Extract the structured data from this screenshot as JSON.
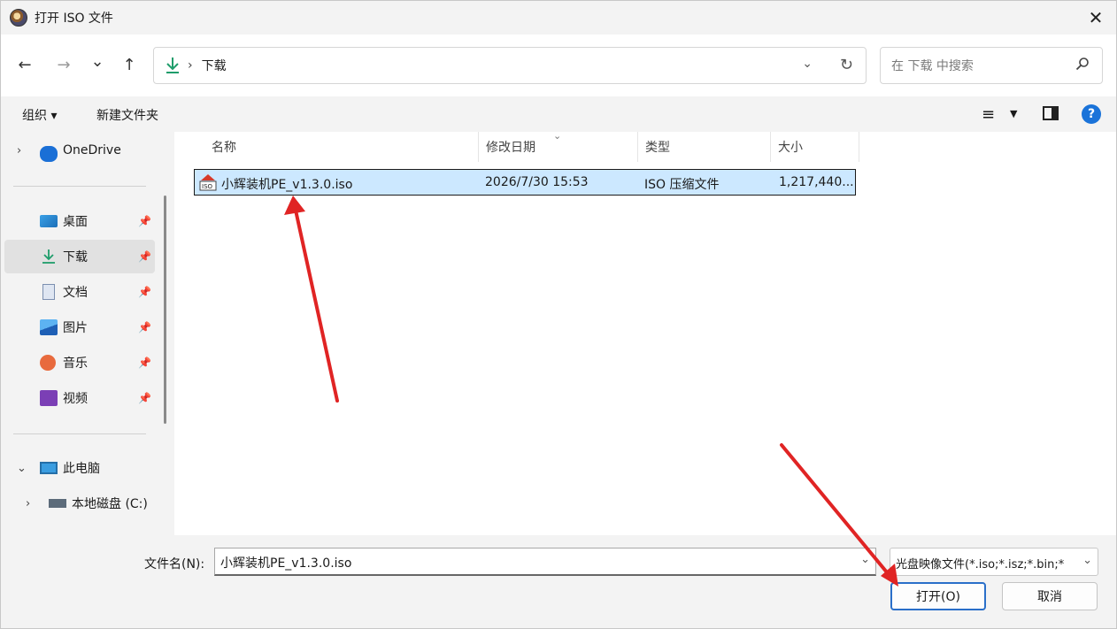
{
  "window": {
    "title": "打开 ISO 文件",
    "close_glyph": "✕"
  },
  "nav": {
    "back_glyph": "←",
    "forward_glyph": "→",
    "recent_glyph": "⌄",
    "up_glyph": "↑",
    "breadcrumb_sep": "›",
    "path": "下载",
    "address_dropdown_glyph": "⌄",
    "refresh_glyph": "↻",
    "search_placeholder": "在 下载 中搜索"
  },
  "toolbar": {
    "organize": "组织 ▾",
    "new_folder": "新建文件夹",
    "view_glyph": "≡",
    "view_caret": "▼",
    "help": "?"
  },
  "sidebar": {
    "items": [
      {
        "label": "OneDrive",
        "icon": "onedrive-icon",
        "pinned": false
      },
      {
        "label": "桌面",
        "icon": "desktop-icon",
        "pinned": true
      },
      {
        "label": "下载",
        "icon": "download-icon",
        "pinned": true,
        "selected": true
      },
      {
        "label": "文档",
        "icon": "documents-icon",
        "pinned": true
      },
      {
        "label": "图片",
        "icon": "pictures-icon",
        "pinned": true
      },
      {
        "label": "音乐",
        "icon": "music-icon",
        "pinned": true
      },
      {
        "label": "视频",
        "icon": "videos-icon",
        "pinned": true
      },
      {
        "label": "此电脑",
        "icon": "this-pc-icon"
      },
      {
        "label": "本地磁盘 (C:)",
        "icon": "drive-icon"
      }
    ],
    "expand_glyph": "›",
    "collapse_glyph": "⌄",
    "pin_glyph": "📌"
  },
  "columns": [
    "名称",
    "修改日期",
    "类型",
    "大小"
  ],
  "files": [
    {
      "name": "小辉装机PE_v1.3.0.iso",
      "modified": "2026/7/30 15:53",
      "type": "ISO 压缩文件",
      "size": "1,217,440..."
    }
  ],
  "bottom": {
    "filename_label": "文件名(N):",
    "filename_value": "小辉装机PE_v1.3.0.iso",
    "filetype_value": "光盘映像文件(*.iso;*.isz;*.bin;*",
    "dropdown_glyph": "⌄",
    "open_label": "打开(O)",
    "cancel_label": "取消"
  },
  "colors": {
    "accent": "#2a6fc9",
    "selection": "#cce8ff",
    "annotation_arrow": "#e02424"
  }
}
